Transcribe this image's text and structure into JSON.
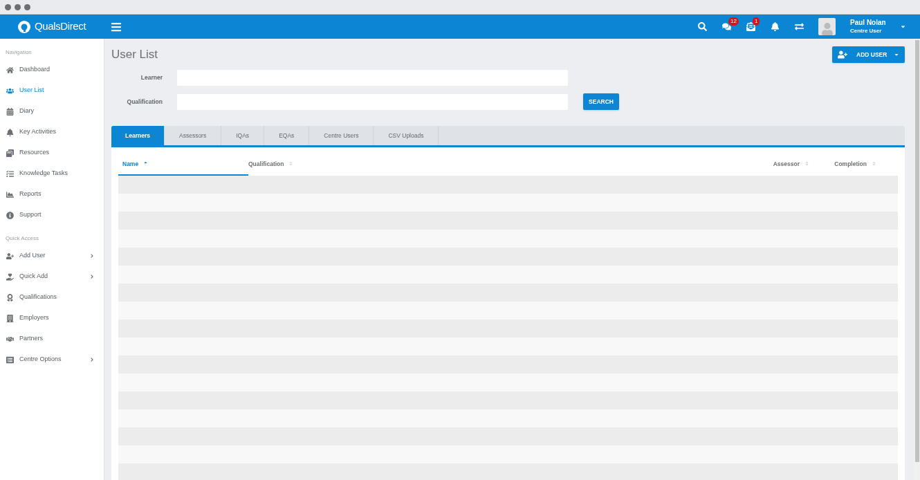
{
  "header": {
    "logo": "QualsDirect",
    "icons": [
      {
        "kind": "search"
      },
      {
        "kind": "chat",
        "badge": "12"
      },
      {
        "kind": "mail",
        "badge": "1"
      },
      {
        "kind": "bell"
      },
      {
        "kind": "swap"
      }
    ],
    "user": {
      "name": "Paul Nolan",
      "role": "Centre User"
    }
  },
  "sidebar": {
    "sections": [
      {
        "title": "Navigation",
        "items": [
          {
            "label": "Dashboard",
            "selected": false,
            "expandable": false
          },
          {
            "label": "User List",
            "selected": true,
            "expandable": false
          },
          {
            "label": "Diary",
            "selected": false,
            "expandable": false
          },
          {
            "label": "Key Activities",
            "selected": false,
            "expandable": false
          },
          {
            "label": "Resources",
            "selected": false,
            "expandable": false
          },
          {
            "label": "Knowledge Tasks",
            "selected": false,
            "expandable": false
          },
          {
            "label": "Reports",
            "selected": false,
            "expandable": false
          },
          {
            "label": "Support",
            "selected": false,
            "expandable": false
          }
        ]
      },
      {
        "title": "Quick Access",
        "items": [
          {
            "label": "Add User",
            "selected": false,
            "expandable": true
          },
          {
            "label": "Quick Add",
            "selected": false,
            "expandable": true
          },
          {
            "label": "Qualifications",
            "selected": false,
            "expandable": false
          },
          {
            "label": "Employers",
            "selected": false,
            "expandable": false
          },
          {
            "label": "Partners",
            "selected": false,
            "expandable": false
          },
          {
            "label": "Centre Options",
            "selected": false,
            "expandable": true
          }
        ]
      }
    ]
  },
  "page": {
    "title": "User List",
    "add_button": "ADD USER",
    "filters": [
      {
        "label": "Learner"
      },
      {
        "label": "Qualification"
      }
    ],
    "search_button": "SEARCH",
    "tabs": [
      {
        "label": "Learners",
        "selected": true
      },
      {
        "label": "Assessors",
        "selected": false
      },
      {
        "label": "IQAs",
        "selected": false
      },
      {
        "label": "EQAs",
        "selected": false
      },
      {
        "label": "Centre Users",
        "selected": false
      },
      {
        "label": "CSV Uploads",
        "selected": false
      }
    ],
    "table": {
      "columns": [
        {
          "label": "Name",
          "sorted": true
        },
        {
          "label": "Qualification",
          "sorted": false
        },
        {
          "label": "Assessor",
          "sorted": false
        },
        {
          "label": "Completion",
          "sorted": false
        }
      ]
    }
  }
}
